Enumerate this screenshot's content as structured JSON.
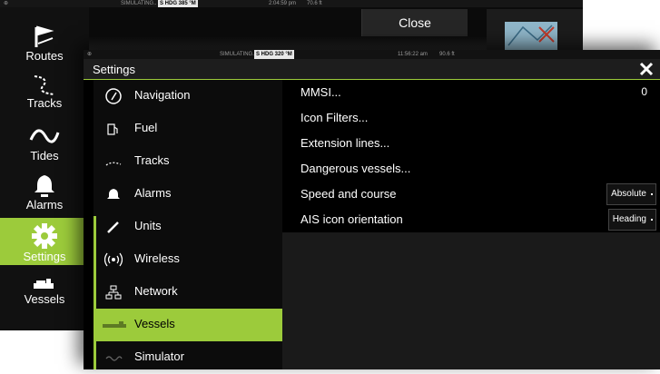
{
  "background": {
    "status_sim": "SIMULATING..",
    "status_hdg": "S HDG 385 °M",
    "status_time": "2:04:59 pm",
    "status_depth": "70.6 ft",
    "close_label": "Close",
    "sidebar": [
      {
        "label": "Routes",
        "icon": "route-icon"
      },
      {
        "label": "Tracks",
        "icon": "tracks-icon"
      },
      {
        "label": "Tides",
        "icon": "tides-icon"
      },
      {
        "label": "Alarms",
        "icon": "bell-icon"
      },
      {
        "label": "Settings",
        "icon": "gear-icon"
      },
      {
        "label": "Vessels",
        "icon": "vessel-icon"
      }
    ]
  },
  "dialog": {
    "status_sim": "SIMULATING..",
    "status_hdg": "S HDG 320 °M",
    "status_time": "11:56:22 am",
    "status_depth": "90.6 ft",
    "title": "Settings",
    "menu": [
      {
        "label": "Navigation",
        "icon": "compass-icon"
      },
      {
        "label": "Fuel",
        "icon": "fuel-icon"
      },
      {
        "label": "Tracks",
        "icon": "tracks-icon"
      },
      {
        "label": "Alarms",
        "icon": "bell-icon"
      },
      {
        "label": "Units",
        "icon": "units-icon"
      },
      {
        "label": "Wireless",
        "icon": "wireless-icon"
      },
      {
        "label": "Network",
        "icon": "network-icon"
      },
      {
        "label": "Vessels",
        "icon": "vessel-icon",
        "selected": true
      },
      {
        "label": "Simulator",
        "icon": "simulator-icon"
      }
    ],
    "options": [
      {
        "label": "MMSI...",
        "value": "0"
      },
      {
        "label": "Icon Filters..."
      },
      {
        "label": "Extension lines..."
      },
      {
        "label": "Dangerous vessels..."
      },
      {
        "label": "Speed and course",
        "dropdown": "Absolute"
      },
      {
        "label": "AIS icon orientation",
        "dropdown": "Heading"
      }
    ]
  },
  "colors": {
    "accent": "#9ccb3b",
    "background": "#000000",
    "panel": "#1a1a1a"
  }
}
